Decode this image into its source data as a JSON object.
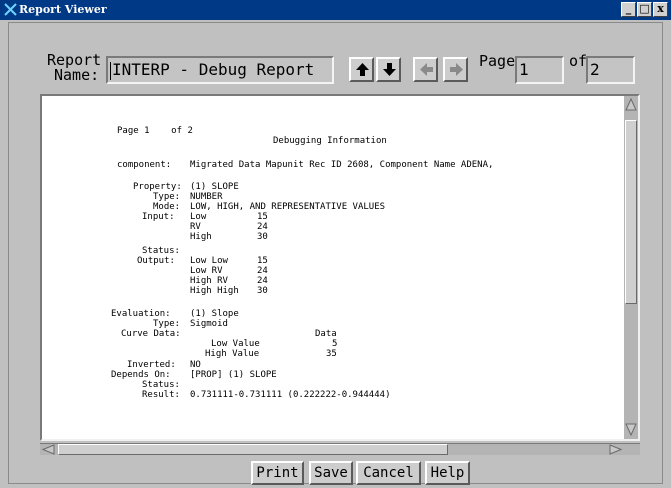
{
  "window": {
    "title": "Report Viewer",
    "controls": {
      "minimize": "_",
      "maximize": "□",
      "close": "x"
    }
  },
  "header": {
    "report_label_line1": "Report",
    "report_label_line2": "Name:",
    "report_name_value": "INTERP - Debug Report",
    "page_label": "Page",
    "page_value": "1",
    "of_label": "of",
    "total_pages": "2",
    "nav_icons": [
      "arrow-up-icon",
      "arrow-down-icon",
      "arrow-left-icon",
      "arrow-right-icon"
    ]
  },
  "report": {
    "page_header": "Page 1    of 2",
    "heading": "Debugging Information",
    "component_label": "component:",
    "component_value": "Migrated Data Mapunit Rec ID 2608, Component Name ADENA,",
    "property_label": "Property:",
    "property_value": "(1) SLOPE",
    "type_label": "Type:",
    "type_value": "NUMBER",
    "mode_label": "Mode:",
    "mode_value": "LOW, HIGH, AND REPRESENTATIVE VALUES",
    "input_label": "Input:",
    "input_rows": [
      {
        "name": "Low",
        "value": "15"
      },
      {
        "name": "RV",
        "value": "24"
      },
      {
        "name": "High",
        "value": "30"
      }
    ],
    "status_label": "Status:",
    "output_label": "Output:",
    "output_rows": [
      {
        "name": "Low Low",
        "value": "15"
      },
      {
        "name": "Low RV",
        "value": "24"
      },
      {
        "name": "High RV",
        "value": "24"
      },
      {
        "name": "High High",
        "value": "30"
      }
    ],
    "evaluation_label": "Evaluation:",
    "evaluation_value": "(1) Slope",
    "eval_type_label": "Type:",
    "eval_type_value": "Sigmoid",
    "curve_label": "Curve Data:",
    "curve_header": "Data",
    "curve_rows": [
      {
        "name": "Low Value",
        "value": "5"
      },
      {
        "name": "High Value",
        "value": "35"
      }
    ],
    "inverted_label": "Inverted:",
    "inverted_value": "NO",
    "depends_label": "Depends On:",
    "depends_value": "[PROP] (1) SLOPE",
    "status2_label": "Status:",
    "result_label": "Result:",
    "result_value": "0.731111-0.731111 (0.222222-0.944444)"
  },
  "buttons": {
    "print": "Print",
    "save": "Save",
    "cancel": "Cancel",
    "help": "Help"
  }
}
